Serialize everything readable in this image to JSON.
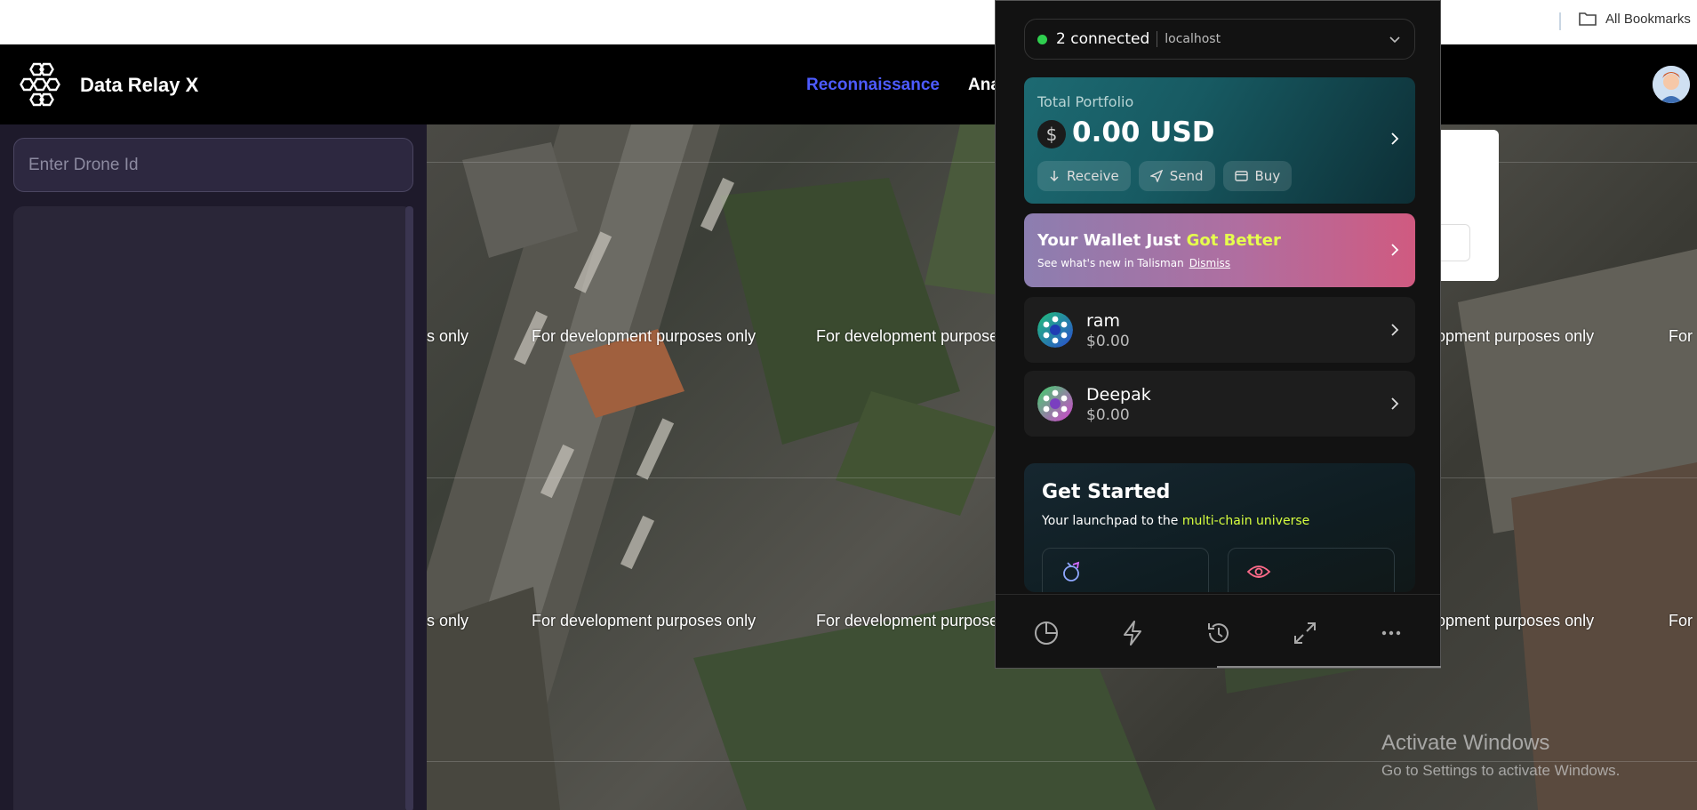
{
  "browser": {
    "bookmarks_label": "All Bookmarks",
    "folder_icon": "folder-icon"
  },
  "header": {
    "app_title": "Data Relay X",
    "logo_icon": "hexagon-cluster-logo",
    "nav": {
      "reconnaissance": "Reconnaissance",
      "analytics_partial": "Ana"
    },
    "accent_color": "#4d5bff"
  },
  "sidebar": {
    "drone_input_placeholder": "Enter Drone Id",
    "drone_input_value": ""
  },
  "map": {
    "watermark_text": "For development purposes only",
    "watermark_row1_partial_left": "s only",
    "watermark_row1_partial_right": "elopment purposes only",
    "watermark_row1_partial_mid": "For development purposes",
    "watermark_row1_partial_edge": "For",
    "activate_title": "Activate Windows",
    "activate_subtitle": "Go to Settings to activate Windows."
  },
  "wallet": {
    "connection": {
      "count_label": "2 connected",
      "host": "localhost",
      "status_color": "#2fcf4f"
    },
    "portfolio": {
      "label": "Total Portfolio",
      "currency_symbol": "$",
      "value": "0.00 USD",
      "buttons": {
        "receive": "Receive",
        "send": "Send",
        "buy": "Buy"
      }
    },
    "promo": {
      "title_prefix": "Your Wallet Just ",
      "title_highlight": "Got Better",
      "subtitle": "See what's new in Talisman",
      "dismiss": "Dismiss"
    },
    "accounts": [
      {
        "name": "ram",
        "balance": "$0.00"
      },
      {
        "name": "Deepak",
        "balance": "$0.00"
      }
    ],
    "get_started": {
      "title": "Get Started",
      "subtitle_prefix": "Your launchpad to the ",
      "subtitle_highlight": "multi-chain universe"
    },
    "footer_icons": [
      "portfolio-pie-icon",
      "quick-actions-bolt-icon",
      "history-icon",
      "expand-icon",
      "more-icon"
    ]
  }
}
